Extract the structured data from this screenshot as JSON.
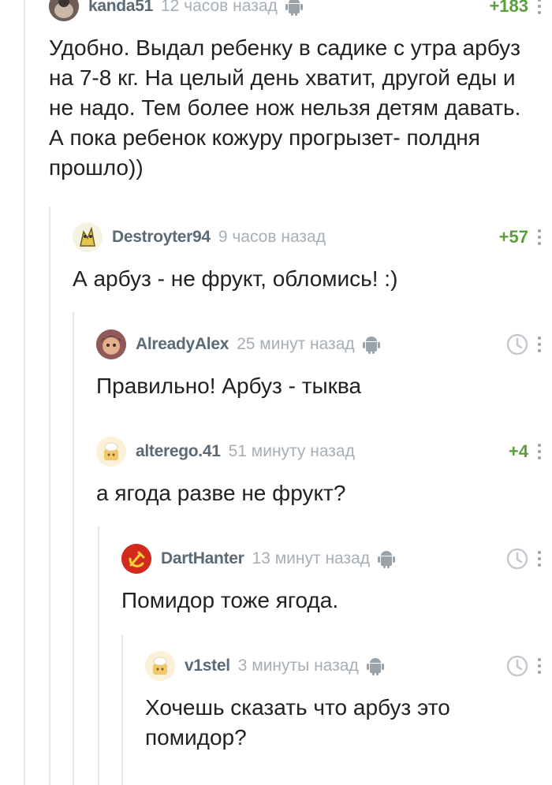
{
  "comments": [
    {
      "author": "kanda51",
      "time": "12 часов назад",
      "score": "+183",
      "device": "android",
      "text": "Удобно. Выдал ребенку в садике с утра арбуз на 7-8 кг. На целый день хватит, другой еды и не надо. Тем более нож нельзя детям давать. А пока ребенок кожуру прогрызет- полдня прошло))"
    },
    {
      "author": "Destroyter94",
      "time": "9 часов назад",
      "score": "+57",
      "text": "А арбуз - не фрукт, обломись! :)"
    },
    {
      "author": "AlreadyAlex",
      "time": "25 минут назад",
      "device": "android",
      "text": "Правильно! Арбуз - тыква"
    },
    {
      "author": "alterego.41",
      "time": "51 минуту назад",
      "score": "+4",
      "text": "а ягода разве не фрукт?"
    },
    {
      "author": "DartHanter",
      "time": "13 минут назад",
      "device": "android",
      "text": "Помидор тоже ягода."
    },
    {
      "author": "v1stel",
      "time": "3 минуты назад",
      "device": "android",
      "text": "Хочешь сказать что арбуз это помидор?"
    }
  ],
  "colors": {
    "author": "#5c6a75",
    "time": "#a7afb6",
    "score_positive": "#5b9f3d",
    "thread_line": "#e6e6e6"
  },
  "icons": [
    "android-icon",
    "clock-icon",
    "more-options-icon",
    "avatar"
  ]
}
